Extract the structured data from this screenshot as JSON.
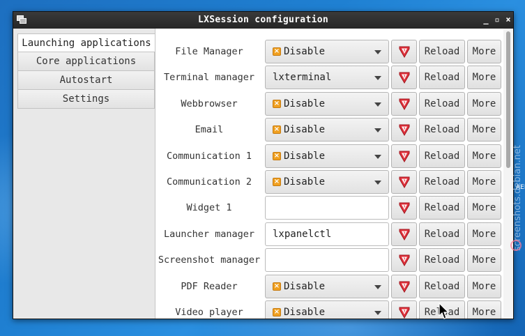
{
  "window": {
    "title": "LXSession configuration",
    "controls": {
      "minimize": "_",
      "maximize": "▫",
      "close": "×"
    }
  },
  "sidebar": {
    "tabs": [
      {
        "label": "Launching applications",
        "active": true
      },
      {
        "label": "Core applications",
        "active": false
      },
      {
        "label": "Autostart",
        "active": false
      },
      {
        "label": "Settings",
        "active": false
      }
    ]
  },
  "buttons": {
    "reload": "Reload",
    "more": "More"
  },
  "rows": [
    {
      "label": "File Manager",
      "kind": "combo",
      "value": "Disable",
      "disable_icon": true
    },
    {
      "label": "Terminal manager",
      "kind": "combo",
      "value": "lxterminal",
      "disable_icon": false
    },
    {
      "label": "Webbrowser",
      "kind": "combo",
      "value": "Disable",
      "disable_icon": true
    },
    {
      "label": "Email",
      "kind": "combo",
      "value": "Disable",
      "disable_icon": true
    },
    {
      "label": "Communication 1",
      "kind": "combo",
      "value": "Disable",
      "disable_icon": true
    },
    {
      "label": "Communication 2",
      "kind": "combo",
      "value": "Disable",
      "disable_icon": true
    },
    {
      "label": "Widget 1",
      "kind": "entry",
      "value": ""
    },
    {
      "label": "Launcher manager",
      "kind": "entry",
      "value": "lxpanelctl"
    },
    {
      "label": "Screenshot manager",
      "kind": "entry",
      "value": ""
    },
    {
      "label": "PDF Reader",
      "kind": "combo",
      "value": "Disable",
      "disable_icon": true
    },
    {
      "label": "Video player",
      "kind": "combo",
      "value": "Disable",
      "disable_icon": true
    }
  ],
  "desktop": {
    "watermark": "screenshots.debian.net",
    "edge_text": "AEN"
  },
  "colors": {
    "titlebar": "#2e2e2e",
    "disable_icon": "#f0a020",
    "shield_red": "#e0313b",
    "desktop": "#1f80d2"
  }
}
